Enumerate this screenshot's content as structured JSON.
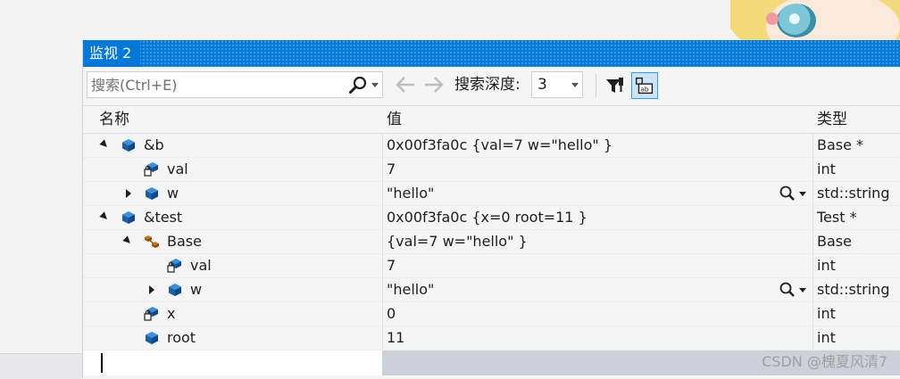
{
  "window": {
    "title": "监视 2",
    "accent_color": "#0078d7"
  },
  "toolbar": {
    "search_placeholder": "搜索(Ctrl+E)",
    "search_icon": "search-icon",
    "back_icon": "arrow-left-icon",
    "forward_icon": "arrow-right-icon",
    "depth_label": "搜索深度:",
    "depth_value": "3",
    "filter_icon": "filter-pin-icon",
    "tab_icon": "tab-view-icon"
  },
  "columns": {
    "name": "名称",
    "value": "值",
    "type": "类型"
  },
  "rows": [
    {
      "name": "&b",
      "value": "0x00f3fa0c {val=7 w=\"hello\" }",
      "type": "Base *",
      "depth": 0,
      "expander": "expanded",
      "icon": "object-icon"
    },
    {
      "name": "val",
      "value": "7",
      "type": "int",
      "depth": 1,
      "expander": "none",
      "icon": "private-field-icon"
    },
    {
      "name": "w",
      "value": "\"hello\"",
      "type": "std::string",
      "depth": 1,
      "expander": "collapsed",
      "icon": "object-icon",
      "visualizer": true
    },
    {
      "name": "&test",
      "value": "0x00f3fa0c {x=0 root=11 }",
      "type": "Test *",
      "depth": 0,
      "expander": "expanded",
      "icon": "object-icon"
    },
    {
      "name": "Base",
      "value": "{val=7 w=\"hello\" }",
      "type": "Base",
      "depth": 1,
      "expander": "expanded",
      "icon": "base-class-icon"
    },
    {
      "name": "val",
      "value": "7",
      "type": "int",
      "depth": 2,
      "expander": "none",
      "icon": "private-field-icon"
    },
    {
      "name": "w",
      "value": "\"hello\"",
      "type": "std::string",
      "depth": 2,
      "expander": "collapsed",
      "icon": "object-icon",
      "visualizer": true
    },
    {
      "name": "x",
      "value": "0",
      "type": "int",
      "depth": 1,
      "expander": "none",
      "icon": "private-field-icon"
    },
    {
      "name": "root",
      "value": "11",
      "type": "int",
      "depth": 1,
      "expander": "none",
      "icon": "object-icon"
    }
  ],
  "watermark": "CSDN @槐夏风清7"
}
